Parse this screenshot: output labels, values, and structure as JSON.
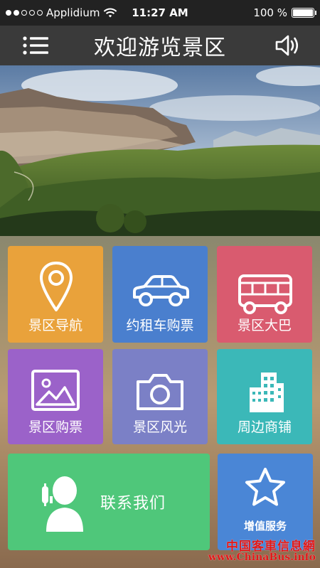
{
  "status_bar": {
    "carrier": "Applidium",
    "time": "11:27 AM",
    "battery": "100 %",
    "battery_level": 1.0,
    "signal_bars_filled": 2,
    "signal_bars_total": 5
  },
  "nav": {
    "title": "欢迎游览景区",
    "menu_icon": "menu-icon",
    "sound_icon": "speaker-icon"
  },
  "tiles": [
    {
      "label": "景区导航",
      "icon": "location-pin-icon",
      "color": "#e9a23b"
    },
    {
      "label": "约租车购票",
      "icon": "car-icon",
      "color": "#4a7fce"
    },
    {
      "label": "景区大巴",
      "icon": "bus-icon",
      "color": "#d95b6f"
    },
    {
      "label": "景区购票",
      "icon": "picture-icon",
      "color": "#9b62c9"
    },
    {
      "label": "景区风光",
      "icon": "camera-icon",
      "color": "#7b80c6"
    },
    {
      "label": "周边商铺",
      "icon": "building-icon",
      "color": "#3bb8b8"
    },
    {
      "label": "联系我们",
      "icon": "customer-service-icon",
      "color": "#4fc77a"
    },
    {
      "label": "增值服务",
      "icon": "star-icon",
      "color": "#4a86d6"
    }
  ],
  "watermark": {
    "line1": "中国客車信息網",
    "line2": "www.ChinaBus.info"
  }
}
